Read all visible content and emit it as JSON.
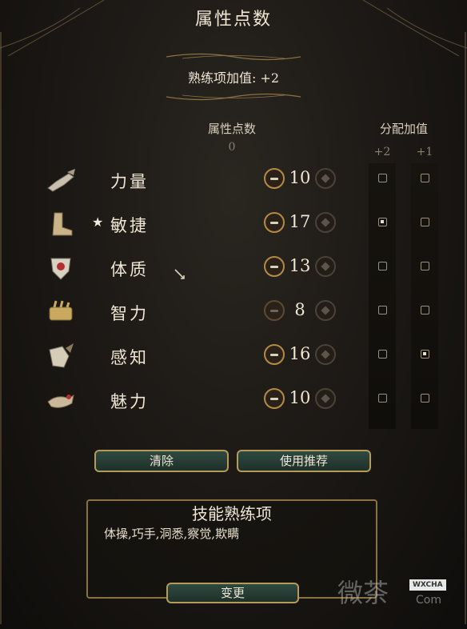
{
  "header": {
    "title": "属性点数",
    "proficiency_bonus": "熟练项加值: +2"
  },
  "columns": {
    "points_label": "属性点数",
    "points_remaining": "0",
    "alloc_label": "分配加值",
    "plus2": "+2",
    "plus1": "+1"
  },
  "abilities": [
    {
      "name": "力量",
      "icon": "strength-arm-icon",
      "score": "10",
      "primary": false,
      "minus_enabled": true,
      "plus2": false,
      "plus1": false
    },
    {
      "name": "敏捷",
      "icon": "dexterity-boot-icon",
      "score": "17",
      "primary": true,
      "minus_enabled": true,
      "plus2": true,
      "plus1": false
    },
    {
      "name": "体质",
      "icon": "constitution-shield-icon",
      "score": "13",
      "primary": false,
      "minus_enabled": true,
      "plus2": false,
      "plus1": false
    },
    {
      "name": "智力",
      "icon": "intelligence-scroll-icon",
      "score": "8",
      "primary": false,
      "minus_enabled": false,
      "plus2": false,
      "plus1": false
    },
    {
      "name": "感知",
      "icon": "wisdom-owl-icon",
      "score": "16",
      "primary": false,
      "minus_enabled": true,
      "plus2": false,
      "plus1": true
    },
    {
      "name": "魅力",
      "icon": "charisma-bird-icon",
      "score": "10",
      "primary": false,
      "minus_enabled": true,
      "plus2": false,
      "plus1": false
    }
  ],
  "actions": {
    "clear_label": "清除",
    "recommend_label": "使用推荐"
  },
  "skills": {
    "title": "技能熟练项",
    "list": "体操,巧手,洞悉,察觉,欺瞒",
    "change_label": "变更"
  },
  "watermark": {
    "text": "微茶",
    "badge": "WXCHA",
    "sub": "Com"
  },
  "colors": {
    "gold": "#b58a44",
    "button_green": "#2f4a40",
    "text": "#efe6d4"
  }
}
